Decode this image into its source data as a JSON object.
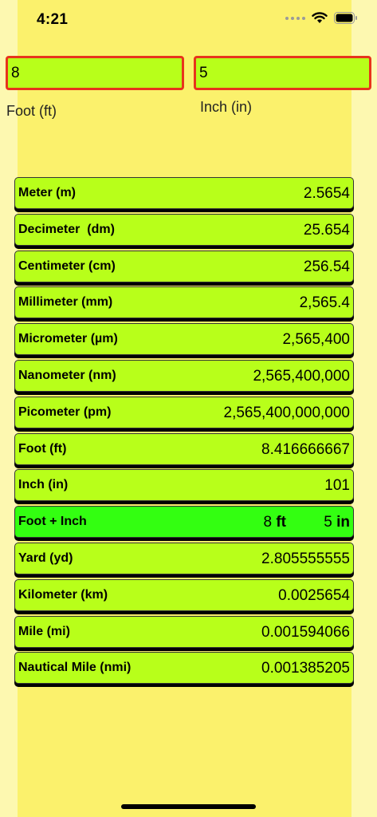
{
  "status": {
    "time": "4:21"
  },
  "inputs": {
    "foot": {
      "value": "8",
      "label": "Foot (ft)"
    },
    "inch": {
      "value": "5",
      "label": "Inch (in)"
    }
  },
  "units": [
    {
      "name": "Meter (m)",
      "value": "2.5654"
    },
    {
      "name": "Decimeter  (dm)",
      "value": "25.654"
    },
    {
      "name": "Centimeter (cm)",
      "value": "256.54"
    },
    {
      "name": "Millimeter (mm)",
      "value": "2,565.4"
    },
    {
      "name": "Micrometer (µm)",
      "value": "2,565,400"
    },
    {
      "name": "Nanometer (nm)",
      "value": "2,565,400,000"
    },
    {
      "name": "Picometer (pm)",
      "value": "2,565,400,000,000"
    },
    {
      "name": "Foot (ft)",
      "value": "8.416666667"
    },
    {
      "name": "Inch (in)",
      "value": "101"
    }
  ],
  "foot_inch": {
    "name": "Foot + Inch",
    "ft_value": "8",
    "ft_unit": "ft",
    "in_value": "5",
    "in_unit": "in"
  },
  "units_after": [
    {
      "name": "Yard (yd)",
      "value": "2.805555555"
    },
    {
      "name": "Kilometer (km)",
      "value": "0.0025654"
    },
    {
      "name": "Mile (mi)",
      "value": "0.001594066"
    },
    {
      "name": "Nautical Mile (nmi)",
      "value": "0.001385205"
    }
  ],
  "colors": {
    "background_outer": "#fdf8b0",
    "background_inner": "#fbf16c",
    "row": "#b8ff1a",
    "row_highlight": "#33ff11",
    "input_border": "#e8341c"
  }
}
